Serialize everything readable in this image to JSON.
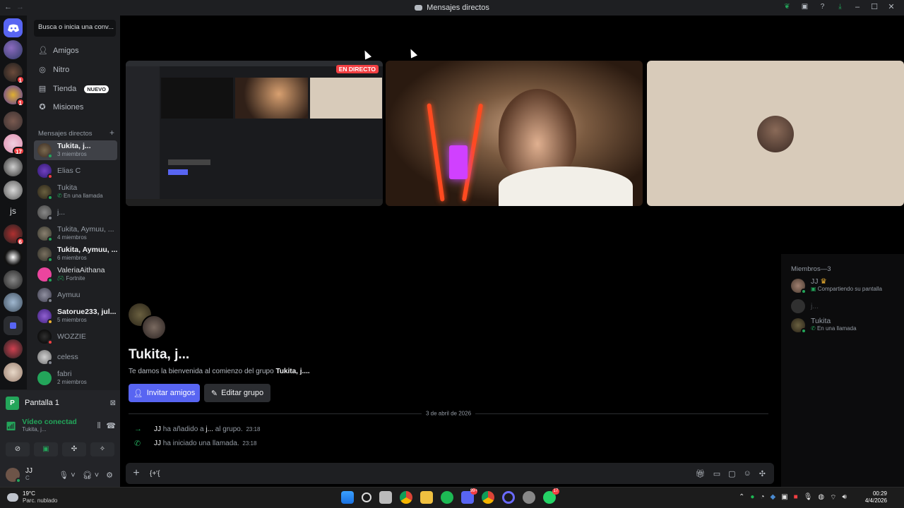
{
  "window": {
    "title": "Mensajes directos"
  },
  "sidebar": {
    "search_placeholder": "Busca o inicia una conv...",
    "nav": [
      {
        "label": "Amigos",
        "icon": "friends-icon"
      },
      {
        "label": "Nitro",
        "icon": "nitro-icon"
      },
      {
        "label": "Tienda",
        "icon": "shop-icon",
        "badge": "NUEVO"
      },
      {
        "label": "Misiones",
        "icon": "quests-icon"
      }
    ],
    "dm_header": "Mensajes directos",
    "dm_add": "+",
    "dms": [
      {
        "name": "Tukita, j...",
        "sub": "3 miembros",
        "bold": true,
        "selected": true
      },
      {
        "name": "Elias C",
        "sub": ""
      },
      {
        "name": "Tukita",
        "sub": "En una llamada"
      },
      {
        "name": "j...",
        "sub": ""
      },
      {
        "name": "Tukita, Aymuu, ...",
        "sub": "4 miembros"
      },
      {
        "name": "Tukita, Aymuu, ...",
        "sub": "6 miembros",
        "bold": true
      },
      {
        "name": "ValeriaAithana",
        "sub": "Fortnite"
      },
      {
        "name": "Aymuu",
        "sub": ""
      },
      {
        "name": "Satorue233, jul...",
        "sub": "5 miembros",
        "bold": true
      },
      {
        "name": "WOZZIE",
        "sub": ""
      },
      {
        "name": "celess",
        "sub": ""
      },
      {
        "name": "fabri",
        "sub": "2 miembros"
      }
    ]
  },
  "rail": {
    "server_badges": [
      "1",
      "1",
      "17",
      "6"
    ],
    "js_label": "js"
  },
  "voice": {
    "screen_label": "Pantalla 1",
    "status": "Vídeo conectad",
    "channel": "Tukita, j..."
  },
  "user": {
    "name": "JJ",
    "status": "C"
  },
  "call": {
    "live_label": "EN DIRECTO"
  },
  "chat": {
    "group_title": "Tukita, j...",
    "welcome_prefix": "Te damos la bienvenida al comienzo del grupo ",
    "welcome_group": "Tukita, j....",
    "invite_label": "Invitar amigos",
    "edit_label": "Editar grupo",
    "date": "3 de abril de 2026",
    "messages": [
      {
        "user": "JJ",
        "text_a": " ha añadido a ",
        "target": "j...",
        "text_b": " al grupo.",
        "time": "23:18",
        "icon": "arrow-right-icon"
      },
      {
        "user": "JJ",
        "text_a": " ha iniciado una llamada.",
        "target": "",
        "text_b": "",
        "time": "23:18",
        "icon": "phone-icon"
      }
    ],
    "composer_value": "{+'{"
  },
  "members": {
    "header": "Miembros—3",
    "list": [
      {
        "name": "JJ",
        "sub": "Compartiendo su pantalla"
      },
      {
        "name": "j...",
        "sub": ""
      },
      {
        "name": "Tukita",
        "sub": "En una llamada"
      }
    ]
  },
  "taskbar": {
    "temp": "19°C",
    "weather": "Parc. nublado",
    "time": "00:29",
    "date": "4/4/2026",
    "app_badges": [
      "99+",
      "17"
    ]
  },
  "colors": {
    "accent": "#5865f2",
    "online": "#23a55a",
    "danger": "#f23f42"
  }
}
